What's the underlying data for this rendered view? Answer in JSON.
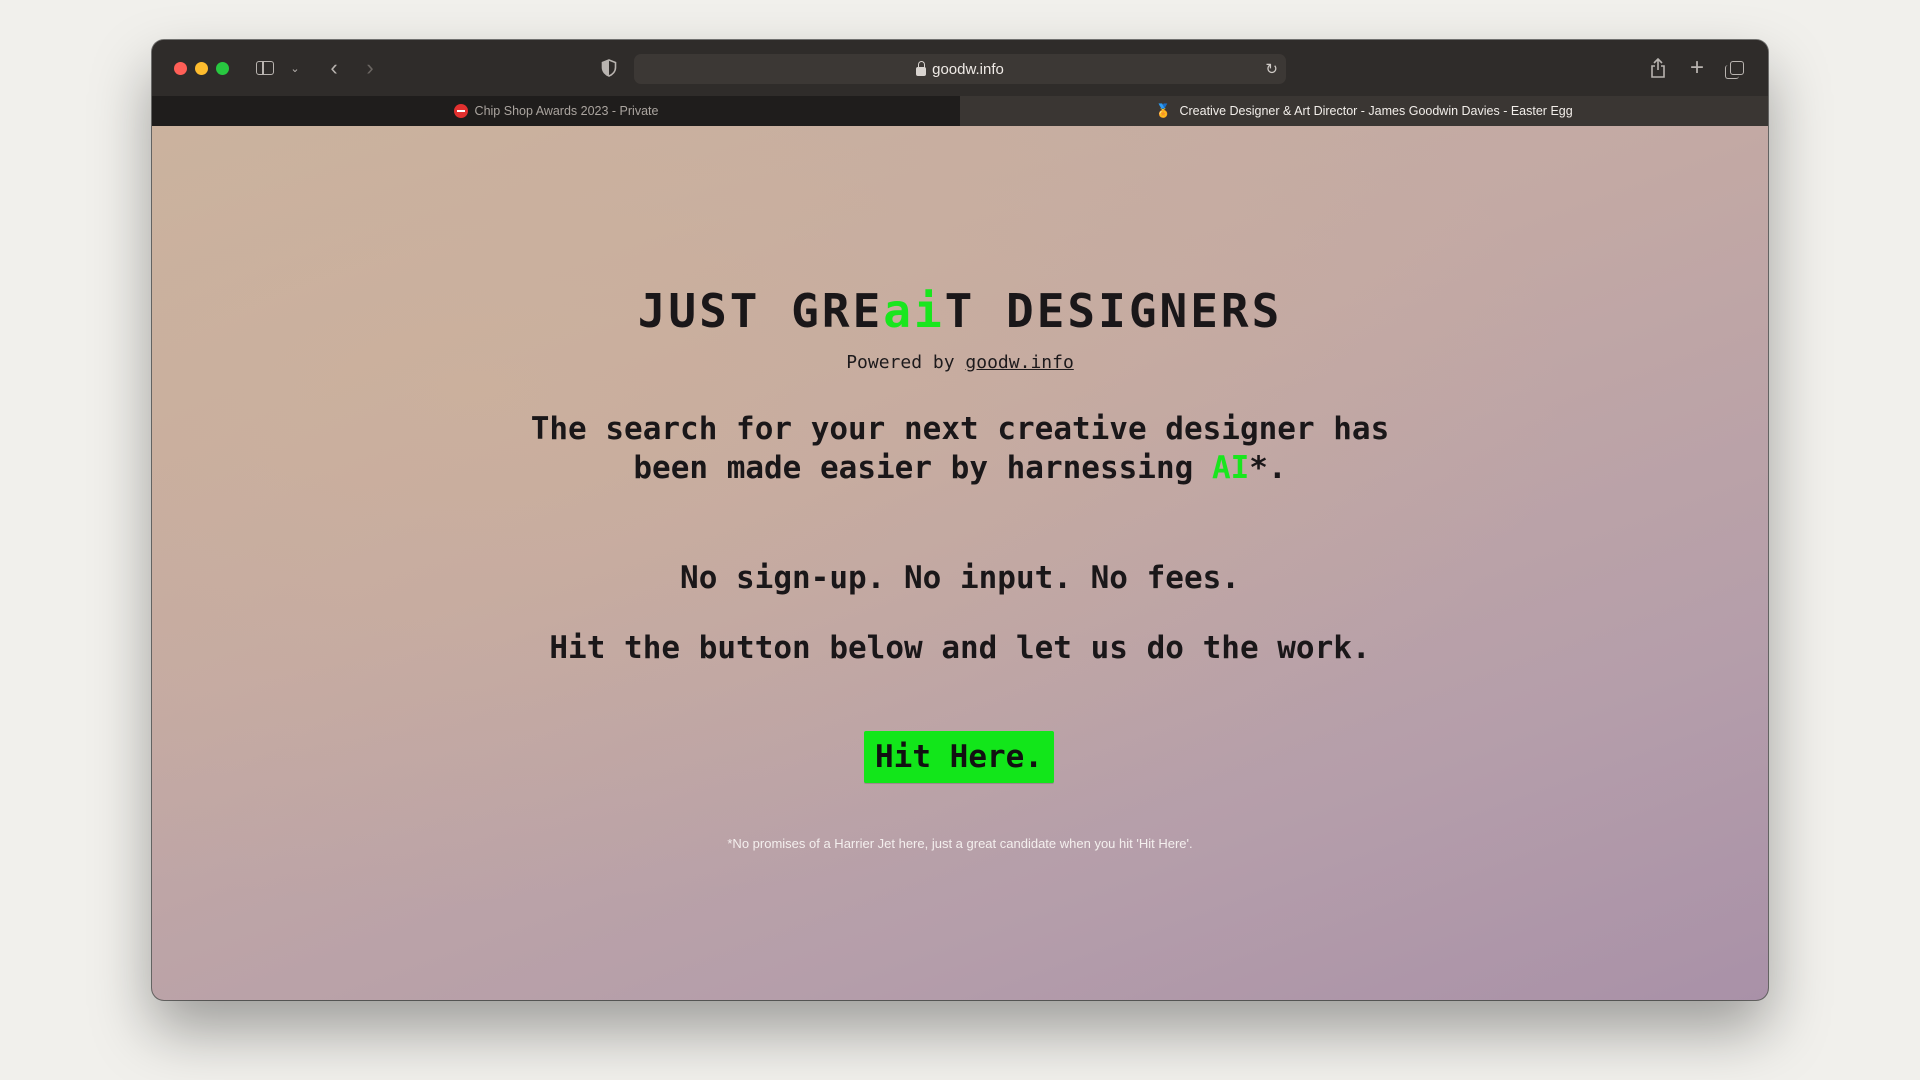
{
  "browser": {
    "url": "goodw.info",
    "tabs": [
      {
        "label": "Chip Shop Awards 2023 - Private",
        "active": false
      },
      {
        "label": "Creative Designer & Art Director - James Goodwin Davies - Easter Egg",
        "active": true
      }
    ],
    "icons": {
      "sidebar": "sidebar-icon",
      "back": "chevron-left-icon",
      "forward": "chevron-right-icon",
      "privacy": "shield-icon",
      "reload": "reload-icon",
      "share": "share-icon",
      "new_tab": "plus-icon",
      "tab_overview": "tabs-overview-icon"
    }
  },
  "page": {
    "title_part1": "JUST GRE",
    "title_ai": "ai",
    "title_part2": "T DESIGNERS",
    "powered_prefix": "Powered by ",
    "powered_link": "goodw.info",
    "lede_line1": "The search for your next creative designer has",
    "lede_line2_prefix": "been made easier by harnessing ",
    "lede_ai": "AI",
    "lede_suffix": "*.",
    "line_no_signup": "No sign-up. No input. No fees.",
    "line_hit": "Hit the button below and let us do the work.",
    "cta_label": "Hit Here.",
    "footnote": "*No promises of a Harrier Jet here, just a great candidate when you hit 'Hit Here'."
  },
  "colors": {
    "accent_green": "#19e61e",
    "button_green": "#12e61a",
    "text_dark": "#1a1719"
  }
}
